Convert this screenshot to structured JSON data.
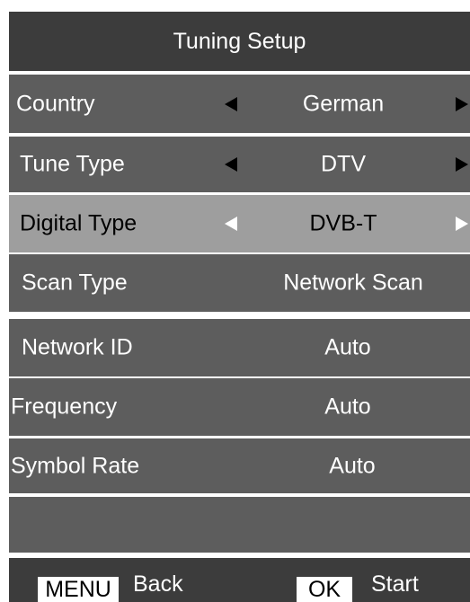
{
  "title": "Tuning Setup",
  "rows": [
    {
      "label": "Country",
      "value": "German",
      "has_arrows": true,
      "selected": false
    },
    {
      "label": "Tune Type",
      "value": "DTV",
      "has_arrows": true,
      "selected": false
    },
    {
      "label": "Digital Type",
      "value": "DVB-T",
      "has_arrows": true,
      "selected": true
    },
    {
      "label": "Scan Type",
      "value": "Network Scan",
      "has_arrows": false,
      "selected": false
    },
    {
      "label": "Network ID",
      "value": "Auto",
      "has_arrows": false,
      "selected": false
    },
    {
      "label": "Frequency",
      "value": "Auto",
      "has_arrows": false,
      "selected": false
    },
    {
      "label": "Symbol Rate",
      "value": "Auto",
      "has_arrows": false,
      "selected": false
    }
  ],
  "footer": {
    "menu_key": "MENU",
    "menu_action": "Back",
    "ok_key": "OK",
    "ok_action": "Start"
  },
  "icons": {
    "left_arrow": "triangle-left-icon",
    "right_arrow": "triangle-right-icon"
  },
  "colors": {
    "title_bg": "#3c3c3c",
    "row_bg": "#5d5d5d",
    "selected_row_bg": "#9e9e9e",
    "text": "#ffffff",
    "selected_text": "#000000"
  }
}
